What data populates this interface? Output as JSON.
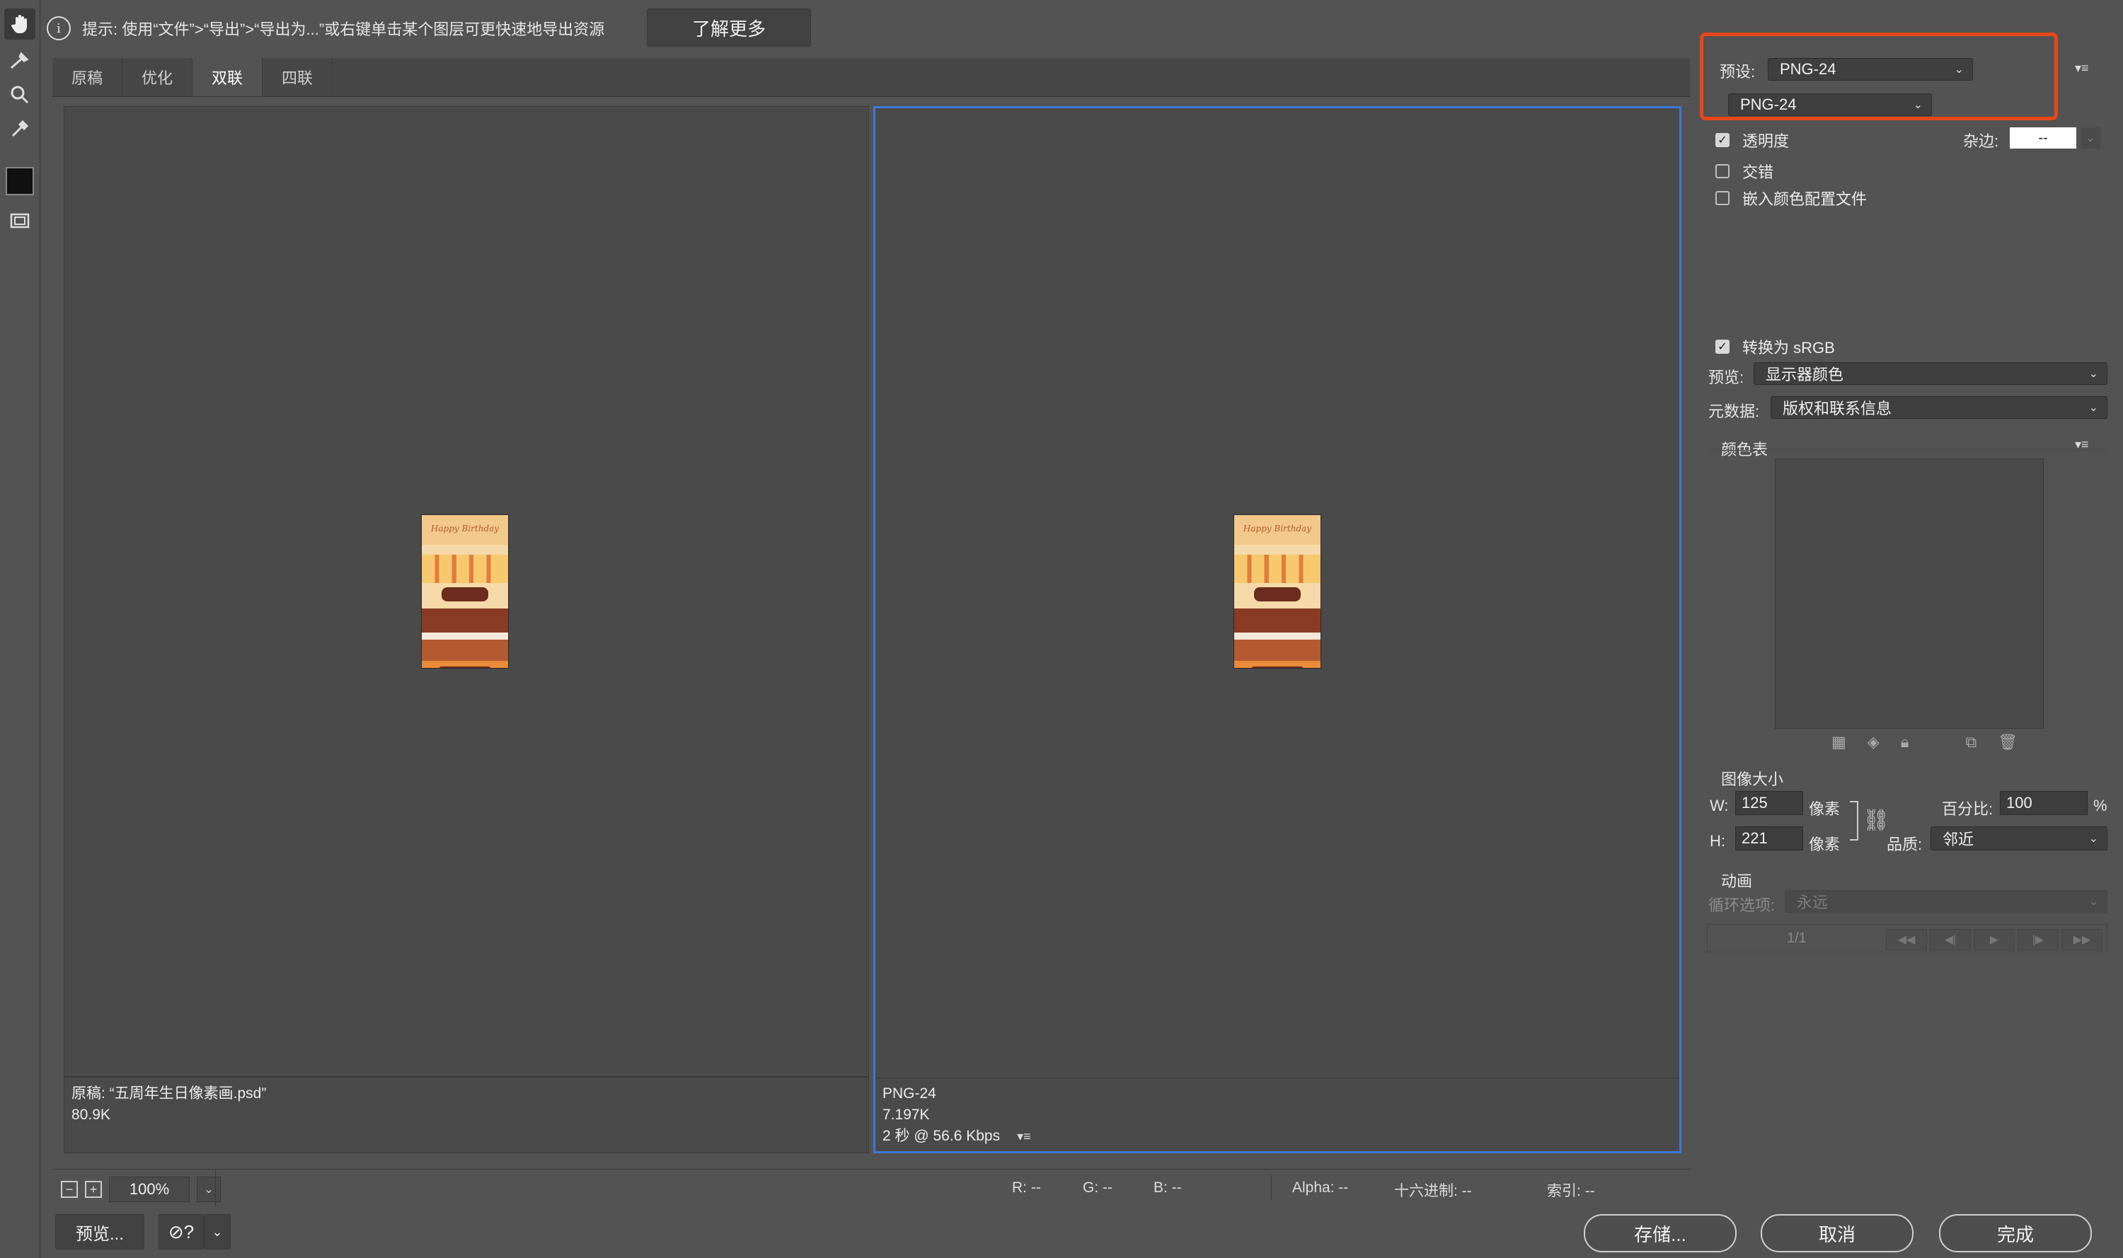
{
  "hint": {
    "text": "提示: 使用“文件”>“导出”>“导出为...”或右键单击某个图层可更快速地导出资源",
    "learn_more": "了解更多"
  },
  "tabs": [
    "原稿",
    "优化",
    "双联",
    "四联"
  ],
  "active_tab": "双联",
  "left_pane": {
    "line1": "原稿: “五周年生日像素画.psd”",
    "line2": "80.9K",
    "thumb_text": "Happy Birthday"
  },
  "right_pane": {
    "line1": "PNG-24",
    "line2": "7.197K",
    "line3": "2 秒 @ 56.6 Kbps",
    "thumb_text": "Happy Birthday"
  },
  "status": {
    "zoom": "100%",
    "r": "R: --",
    "g": "G: --",
    "b": "B: --",
    "alpha": "Alpha: --",
    "hex": "十六进制: --",
    "index": "索引: --"
  },
  "buttons": {
    "preview": "预览...",
    "save": "存储...",
    "cancel": "取消",
    "done": "完成"
  },
  "settings": {
    "preset_label": "预设:",
    "preset_value": "PNG-24",
    "format_value": "PNG-24",
    "transparency": "透明度",
    "transparency_checked": true,
    "matte_label": "杂边:",
    "matte_value": "--",
    "interlaced": "交错",
    "interlaced_checked": false,
    "embed_profile": "嵌入颜色配置文件",
    "embed_profile_checked": false,
    "convert_srgb": "转换为 sRGB",
    "convert_srgb_checked": true,
    "preview_label": "预览:",
    "preview_value": "显示器颜色",
    "metadata_label": "元数据:",
    "metadata_value": "版权和联系信息",
    "color_table_label": "颜色表",
    "image_size_label": "图像大小",
    "w_label": "W:",
    "w_value": "125",
    "h_label": "H:",
    "h_value": "221",
    "unit": "像素",
    "percent_label": "百分比:",
    "percent_value": "100",
    "percent_sign": "%",
    "quality_label": "品质:",
    "quality_value": "邻近",
    "animation_label": "动画",
    "loop_label": "循环选项:",
    "loop_value": "永远",
    "frame_counter": "1/1"
  },
  "colors": {
    "accent": "#3d78d8",
    "highlight": "#e8481a",
    "background": "#535353"
  }
}
